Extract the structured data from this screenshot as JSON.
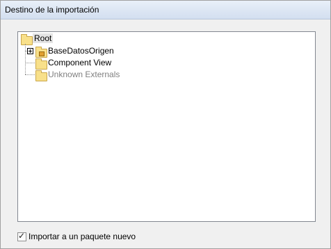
{
  "window": {
    "title": "Destino de la importación"
  },
  "tree": {
    "root_label": "Root",
    "items": [
      {
        "label": "BaseDatosOrigen",
        "expandable": true,
        "icon": "package-folder-icon"
      },
      {
        "label": "Component View",
        "expandable": false,
        "icon": "folder-icon"
      },
      {
        "label": "Unknown Externals",
        "expandable": false,
        "icon": "folder-icon",
        "dimmed": true
      }
    ]
  },
  "options": {
    "new_package_label": "Importar a un paquete nuevo",
    "new_package_checked": true
  },
  "colors": {
    "titlebar": "#dbe5f3",
    "folder": "#f8e08a",
    "dimmed_text": "#808080"
  }
}
